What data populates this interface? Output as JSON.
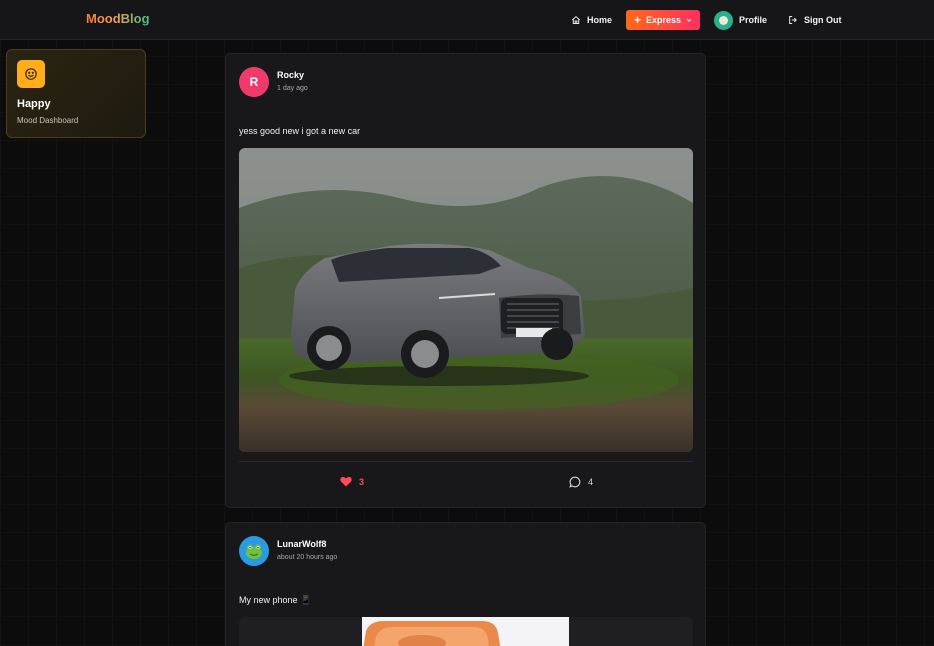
{
  "header": {
    "logo": "MoodBlog",
    "nav": {
      "home": "Home",
      "express": "Express",
      "profile": "Profile",
      "sign_out": "Sign Out"
    }
  },
  "mood": {
    "title": "Happy",
    "subtitle": "Mood Dashboard",
    "icon": "smile-icon",
    "accent": "#ffae1a"
  },
  "posts": [
    {
      "avatar_letter": "R",
      "author": "Rocky",
      "time": "1 day ago",
      "text": "yess good new i got a new car",
      "image": "grey-suv-photo",
      "likes": "3",
      "liked": true,
      "comments": "4"
    },
    {
      "avatar_icon": "frog-avatar-icon",
      "author": "LunarWolf8",
      "time": "about 20 hours ago",
      "text": "My new phone 📱",
      "image": "phone-photo"
    }
  ],
  "colors": {
    "like": "#ff4a58",
    "express_gradient": [
      "#ff6a1a",
      "#ff3060"
    ]
  }
}
